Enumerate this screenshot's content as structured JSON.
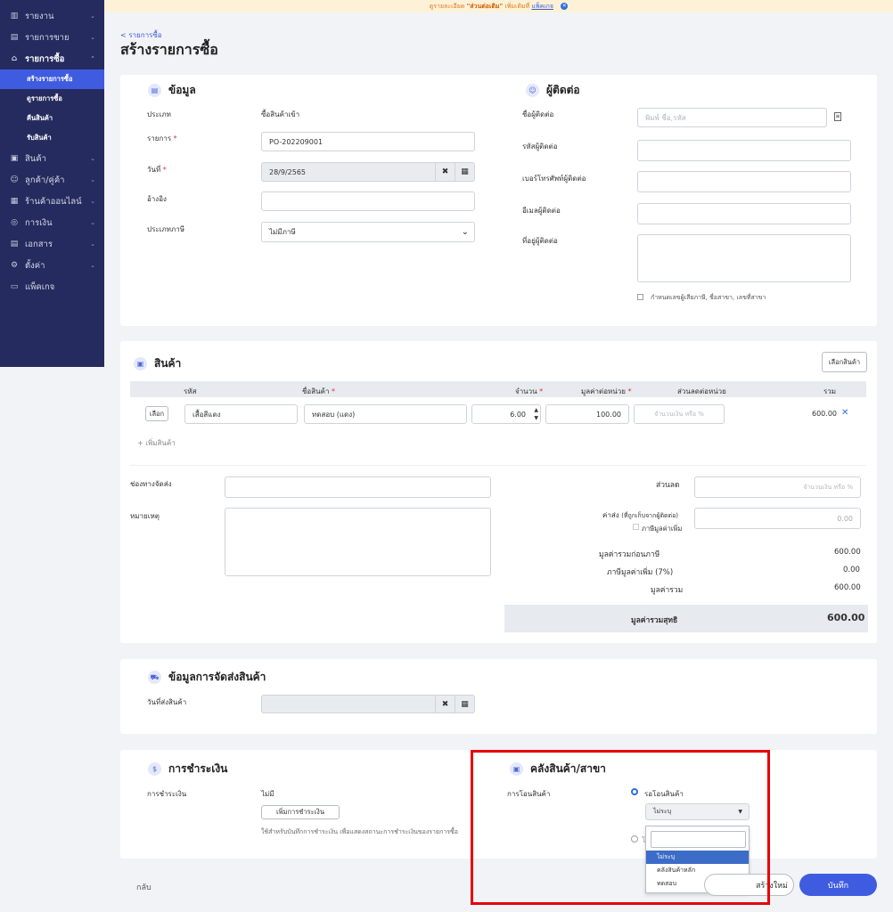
{
  "banner": {
    "prefix": "ดูรายละเอียด ",
    "bold": "\"ส่วนต่อเติม\"",
    "mid": " เพิ่มเติมที่ ",
    "link": "แพ็คเกจ"
  },
  "sidebar": {
    "items": [
      {
        "label": "รายงาน",
        "icon": "chart-icon"
      },
      {
        "label": "รายการขาย",
        "icon": "receipt-icon"
      },
      {
        "label": "รายการซื้อ",
        "icon": "basket-icon"
      }
    ],
    "subitems": [
      "สร้างรายการซื้อ",
      "ดูรายการซื้อ",
      "คืนสินค้า",
      "รับสินค้า"
    ],
    "items2": [
      {
        "label": "สินค้า",
        "icon": "box-icon"
      },
      {
        "label": "ลูกค้า/คู่ค้า",
        "icon": "people-icon"
      },
      {
        "label": "ร้านค้าออนไลน์",
        "icon": "store-icon"
      },
      {
        "label": "การเงิน",
        "icon": "coin-icon"
      },
      {
        "label": "เอกสาร",
        "icon": "document-icon"
      },
      {
        "label": "ตั้งค่า",
        "icon": "gear-icon"
      },
      {
        "label": "แพ็คเกจ",
        "icon": "package-icon"
      }
    ]
  },
  "breadcrumb": "< รายการซื้อ",
  "page_title": "สร้างรายการซื้อ",
  "info": {
    "title": "ข้อมูล",
    "type_label": "ประเภท",
    "type_value": "ซื้อสินค้าเข้า",
    "doc_label": "รายการ",
    "doc_value": "PO-202209001",
    "date_label": "วันที่",
    "date_value": "28/9/2565",
    "ref_label": "อ้างอิง",
    "tax_label": "ประเภทภาษี",
    "tax_value": "ไม่มีภาษี"
  },
  "contact": {
    "title": "ผู้ติดต่อ",
    "name_label": "ชื่อผู้ติดต่อ",
    "name_placeholder": "พิมพ์ ชื่อ,รหัส",
    "code_label": "รหัสผู้ติดต่อ",
    "phone_label": "เบอร์โทรศัพท์ผู้ติดต่อ",
    "email_label": "อีเมลผู้ติดต่อ",
    "address_label": "ที่อยู่ผู้ติดต่อ",
    "tax_check": "กำหนดเลขผู้เสียภาษี, ชื่อสาขา, เลขที่สาขา"
  },
  "products": {
    "title": "สินค้า",
    "select_button": "เลือกสินค้า",
    "columns": {
      "code": "รหัส",
      "name": "ชื่อสินค้า",
      "qty": "จำนวน",
      "price": "มูลค่าต่อหน่วย",
      "discount": "ส่วนลดต่อหน่วย",
      "total": "รวม"
    },
    "row": {
      "pick": "เลือก",
      "code": "เสื้อสีแดง",
      "name": "ทดสอบ (แดง)",
      "qty": "6.00",
      "price": "100.00",
      "discount_placeholder": "จำนวนเงิน หรือ %",
      "total": "600.00"
    },
    "add_link": "+ เพิ่มสินค้า"
  },
  "shipping_channel_label": "ช่องทางจัดส่ง",
  "note_label": "หมายเหตุ",
  "summary": {
    "discount_label": "ส่วนลด",
    "discount_placeholder": "จำนวนเงิน หรือ %",
    "shipping_label": "ค่าส่ง",
    "shipping_hint": "(ที่ถูกเก็บจากผู้ติดต่อ)",
    "shipping_value": "0.00",
    "vat_check": "ภาษีมูลค่าเพิ่ม",
    "pre_tax_label": "มูลค่ารวมก่อนภาษี",
    "pre_tax_value": "600.00",
    "vat_label": "ภาษีมูลค่าเพิ่ม (7%)",
    "vat_value": "0.00",
    "total_label": "มูลค่ารวม",
    "total_value": "600.00",
    "net_label": "มูลค่ารวมสุทธิ",
    "net_value": "600.00"
  },
  "delivery": {
    "title": "ข้อมูลการจัดส่งสินค้า",
    "date_label": "วันที่ส่งสินค้า"
  },
  "payment": {
    "title": "การชำระเงิน",
    "label": "การชำระเงิน",
    "value": "ไม่มี",
    "add_button": "เพิ่มการชำระเงิน",
    "hint": "ใช้สำหรับบันทึกการชำระเงิน เพื่อแสดงสถานะการชำระเงินของรายการซื้อ"
  },
  "warehouse": {
    "title": "คลังสินค้า/สาขา",
    "transfer_label": "การโอนสินค้า",
    "radio_waiting": "รอโอนสินค้า",
    "radio_other": "โ",
    "select_value": "ไม่ระบุ",
    "options": [
      "ไม่ระบุ",
      "คลังสินค้าหลัก",
      "ทดสอบ"
    ]
  },
  "footer": {
    "back": "กลับ",
    "create_new": "สร้างใหม่",
    "save": "บันทึก"
  }
}
